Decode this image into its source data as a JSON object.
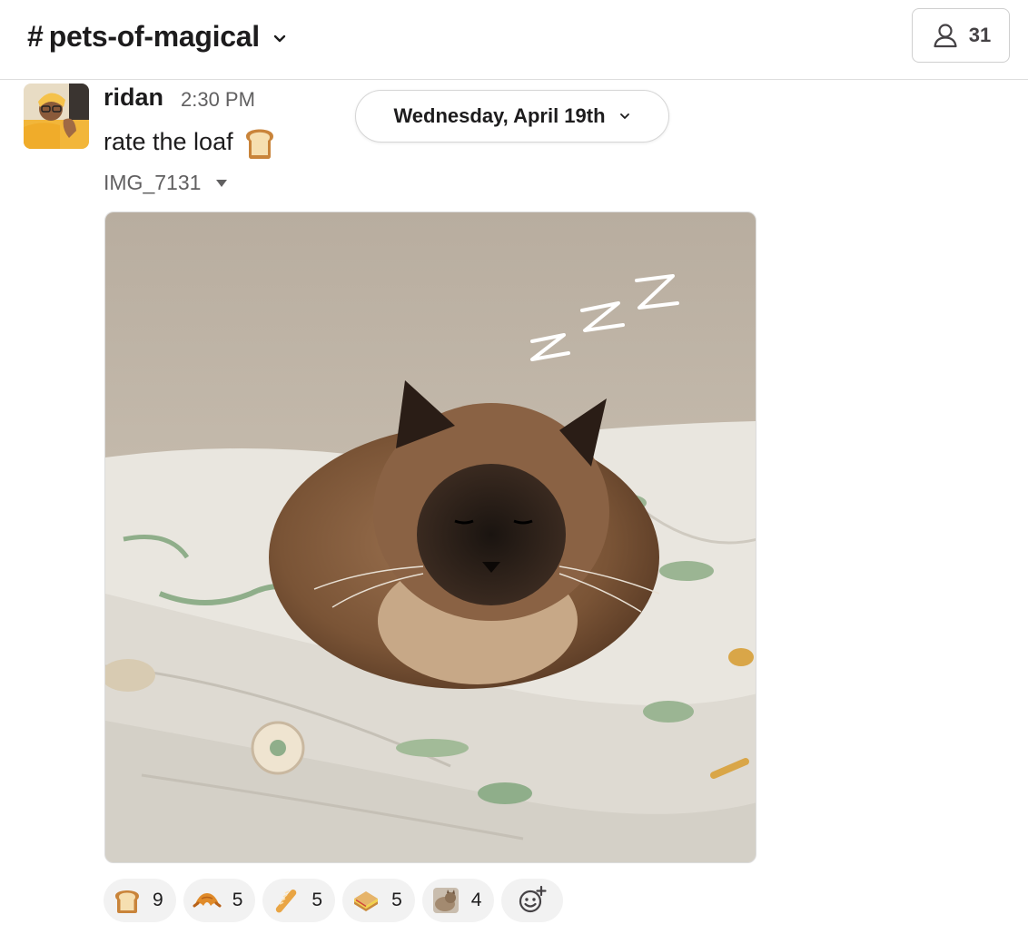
{
  "header": {
    "channel_hash": "#",
    "channel_name": "pets-of-magical",
    "member_count": "31"
  },
  "message": {
    "author": "ridan",
    "time": "2:30 PM",
    "text": "rate the loaf",
    "text_emoji": "bread-emoji",
    "attachment_name": "IMG_7131"
  },
  "date_divider": {
    "label": "Wednesday, April 19th"
  },
  "reactions": [
    {
      "emoji": "bread",
      "count": "9"
    },
    {
      "emoji": "croissant",
      "count": "5"
    },
    {
      "emoji": "baguette",
      "count": "5"
    },
    {
      "emoji": "sandwich",
      "count": "5"
    },
    {
      "emoji": "loaf-cat",
      "count": "4"
    }
  ],
  "colors": {
    "text": "#1d1c1d",
    "muted": "#616061",
    "reaction_bg": "#f2f2f2",
    "border": "#dddddd"
  }
}
